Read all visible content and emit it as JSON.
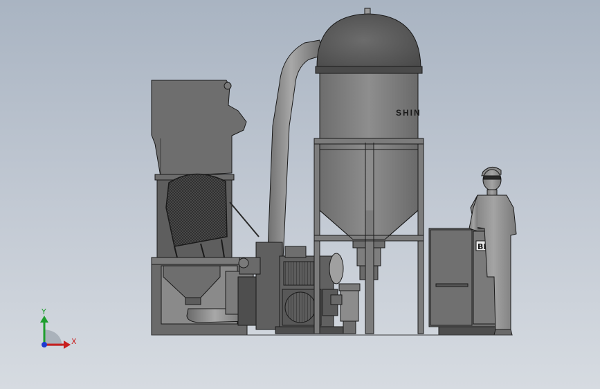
{
  "scene": {
    "silo_label": "SHIN",
    "panel_label": "BBB"
  },
  "triad": {
    "x_label": "X",
    "y_label": "Y",
    "x_color": "#c81e1e",
    "y_color": "#1e9e2e",
    "z_color": "#1e3ad0"
  },
  "colors": {
    "metal_dark": "#5a5a5a",
    "metal_mid": "#7a7a7a",
    "metal_light": "#9a9a9a",
    "outline": "#1a1a1a"
  }
}
